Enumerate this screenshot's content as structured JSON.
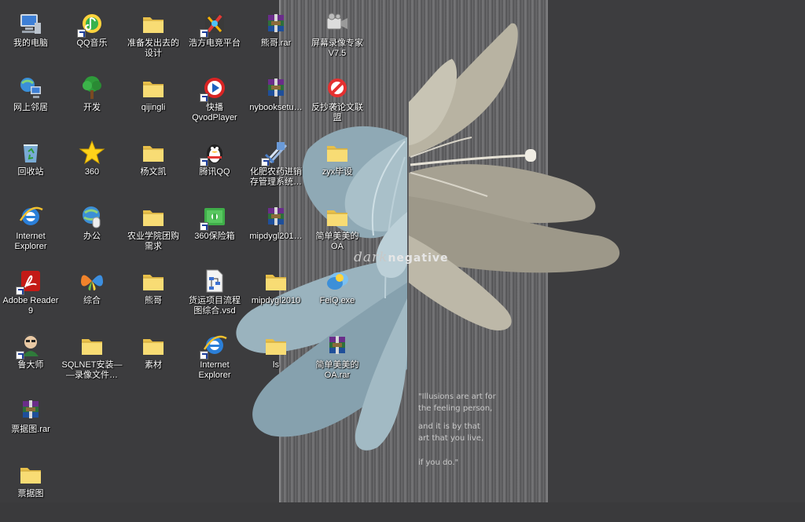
{
  "wallpaper": {
    "logo_script": "dark",
    "logo_word": "negative",
    "quote": [
      "\"Illusions are art for",
      "the feeling person,",
      "and it is by that",
      "art that you live,",
      "if you do.\""
    ]
  },
  "icons": [
    {
      "label": "我的电脑",
      "icon": "computer-icon",
      "shortcut": false
    },
    {
      "label": "网上邻居",
      "icon": "network-icon",
      "shortcut": false
    },
    {
      "label": "回收站",
      "icon": "recycle-bin-icon",
      "shortcut": false
    },
    {
      "label": "Internet\nExplorer",
      "icon": "ie-icon",
      "shortcut": false
    },
    {
      "label": "Adobe Reader\n9",
      "icon": "adobe-reader-icon",
      "shortcut": true
    },
    {
      "label": "鲁大师",
      "icon": "ludashi-icon",
      "shortcut": true
    },
    {
      "label": "票据图.rar",
      "icon": "rar-icon",
      "shortcut": false
    },
    {
      "label": "票据图",
      "icon": "folder-icon",
      "shortcut": false
    },
    {
      "label": "QQ音乐",
      "icon": "qq-music-icon",
      "shortcut": true
    },
    {
      "label": "开发",
      "icon": "tree-icon",
      "shortcut": false
    },
    {
      "label": "360",
      "icon": "star-icon",
      "shortcut": false
    },
    {
      "label": "办公",
      "icon": "globe-mouse-icon",
      "shortcut": false
    },
    {
      "label": "综合",
      "icon": "butterfly-icon",
      "shortcut": false
    },
    {
      "label": "SQLNET安装—\n—录像文件…",
      "icon": "folder-icon",
      "shortcut": false
    },
    {
      "label": "准备发出去的\n设计",
      "icon": "folder-icon",
      "shortcut": false
    },
    {
      "label": "qijingli",
      "icon": "folder-icon",
      "shortcut": false
    },
    {
      "label": "杨文凯",
      "icon": "folder-icon",
      "shortcut": false
    },
    {
      "label": "农业学院团购\n需求",
      "icon": "folder-icon",
      "shortcut": false
    },
    {
      "label": "熊哥",
      "icon": "folder-icon",
      "shortcut": false
    },
    {
      "label": "素材",
      "icon": "folder-icon",
      "shortcut": false
    },
    {
      "label": "浩方电竞平台",
      "icon": "haofang-icon",
      "shortcut": true
    },
    {
      "label": "快播\nQvodPlayer",
      "icon": "qvod-icon",
      "shortcut": true
    },
    {
      "label": "腾讯QQ",
      "icon": "qq-penguin-icon",
      "shortcut": true
    },
    {
      "label": "360保险箱",
      "icon": "safe-box-icon",
      "shortcut": true
    },
    {
      "label": "货运项目流程\n图综合.vsd",
      "icon": "visio-doc-icon",
      "shortcut": false
    },
    {
      "label": "Internet\nExplorer",
      "icon": "ie-icon",
      "shortcut": true
    },
    {
      "label": "熊哥.rar",
      "icon": "rar-icon",
      "shortcut": false
    },
    {
      "label": "nybooksetu…",
      "icon": "rar-icon",
      "shortcut": false
    },
    {
      "label": "化肥农药进销\n存管理系统…",
      "icon": "setup-icon",
      "shortcut": true
    },
    {
      "label": "mipdygl201…",
      "icon": "rar-icon",
      "shortcut": false
    },
    {
      "label": "mipdygl2010",
      "icon": "folder-icon",
      "shortcut": false
    },
    {
      "label": "ls",
      "icon": "folder-icon",
      "shortcut": false
    },
    {
      "label": "屏幕录像专家\nV7.5",
      "icon": "camera-icon",
      "shortcut": false
    },
    {
      "label": "反抄袭论文联\n盟",
      "icon": "no-sign-icon",
      "shortcut": false
    },
    {
      "label": "zyx毕设",
      "icon": "folder-icon",
      "shortcut": false
    },
    {
      "label": "简单美美的\nOA",
      "icon": "folder-icon",
      "shortcut": false
    },
    {
      "label": "FeiQ.exe",
      "icon": "feiq-icon",
      "shortcut": false
    },
    {
      "label": "简单美美的\nOA.rar",
      "icon": "rar-icon",
      "shortcut": false
    }
  ]
}
